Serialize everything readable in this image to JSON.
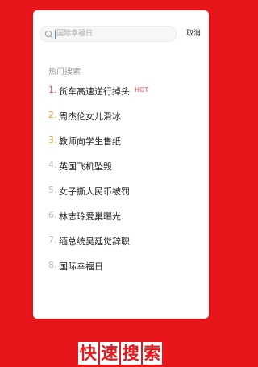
{
  "search": {
    "placeholder": "国际幸福日",
    "cancel_label": "取消"
  },
  "hot_section": {
    "title": "热门搜索",
    "hot_badge": "HOT",
    "items": [
      {
        "rank": "1.",
        "title": "货车高速逆行掉头"
      },
      {
        "rank": "2.",
        "title": "周杰伦女儿滑冰"
      },
      {
        "rank": "3.",
        "title": "教师向学生售纸"
      },
      {
        "rank": "4.",
        "title": "英国飞机坠毁"
      },
      {
        "rank": "5.",
        "title": "女子撕人民币被罚"
      },
      {
        "rank": "6.",
        "title": "林志玲爱巢曝光"
      },
      {
        "rank": "7.",
        "title": "缅总统吴廷觉辞职"
      },
      {
        "rank": "8.",
        "title": "国际幸福日"
      }
    ]
  },
  "footer": {
    "chars": [
      "快",
      "速",
      "搜",
      "索"
    ]
  },
  "colors": {
    "background": "#e8161a",
    "rank1": "#e94b56",
    "rank2": "#f0a23a",
    "rank3": "#f3b33d"
  }
}
